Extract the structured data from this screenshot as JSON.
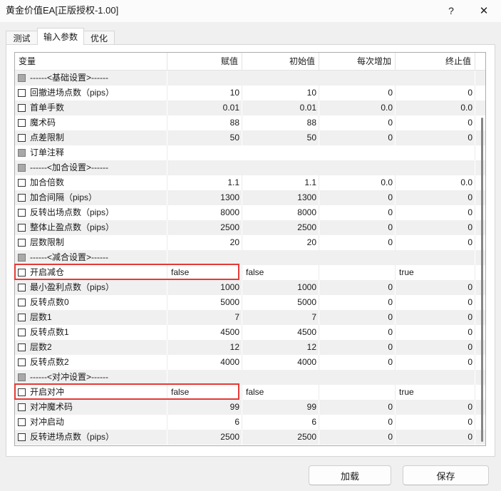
{
  "window": {
    "title": "黄金价值EA[正版授权-1.00]",
    "help_glyph": "?",
    "close_glyph": "✕"
  },
  "icons": {
    "help": "question-mark-icon",
    "close": "close-icon",
    "checkbox": "checkbox-icon"
  },
  "tabs": [
    {
      "label": "测试",
      "active": false
    },
    {
      "label": "输入参数",
      "active": true
    },
    {
      "label": "优化",
      "active": false
    }
  ],
  "table": {
    "columns": [
      "变量",
      "赋值",
      "初始值",
      "每次增加",
      "终止值"
    ],
    "rows": [
      {
        "name": "------<基础设置>------",
        "section": true
      },
      {
        "name": "回撤进场点数（pips）",
        "value": "10",
        "start": "10",
        "step": "0",
        "stop": "0"
      },
      {
        "name": "首单手数",
        "value": "0.01",
        "start": "0.01",
        "step": "0.0",
        "stop": "0.0"
      },
      {
        "name": "魔术码",
        "value": "88",
        "start": "88",
        "step": "0",
        "stop": "0"
      },
      {
        "name": "点差限制",
        "value": "50",
        "start": "50",
        "step": "0",
        "stop": "0"
      },
      {
        "name": "订单注释",
        "checkbox_disabled": true,
        "single_value": true,
        "value": ""
      },
      {
        "name": "------<加合设置>------",
        "section": true
      },
      {
        "name": "加合倍数",
        "value": "1.1",
        "start": "1.1",
        "step": "0.0",
        "stop": "0.0"
      },
      {
        "name": "加合间隔（pips）",
        "value": "1300",
        "start": "1300",
        "step": "0",
        "stop": "0"
      },
      {
        "name": "反转出场点数（pips）",
        "value": "8000",
        "start": "8000",
        "step": "0",
        "stop": "0"
      },
      {
        "name": "整体止盈点数（pips）",
        "value": "2500",
        "start": "2500",
        "step": "0",
        "stop": "0"
      },
      {
        "name": "层数限制",
        "value": "20",
        "start": "20",
        "step": "0",
        "stop": "0"
      },
      {
        "name": "------<减合设置>------",
        "section": true
      },
      {
        "name": "开启减仓",
        "boolean": true,
        "highlighted": true,
        "value": "false",
        "start": "false",
        "step": "",
        "stop": "true"
      },
      {
        "name": "最小盈利点数（pips）",
        "value": "1000",
        "start": "1000",
        "step": "0",
        "stop": "0"
      },
      {
        "name": "反转点数0",
        "value": "5000",
        "start": "5000",
        "step": "0",
        "stop": "0"
      },
      {
        "name": "层数1",
        "value": "7",
        "start": "7",
        "step": "0",
        "stop": "0"
      },
      {
        "name": "反转点数1",
        "value": "4500",
        "start": "4500",
        "step": "0",
        "stop": "0"
      },
      {
        "name": "层数2",
        "value": "12",
        "start": "12",
        "step": "0",
        "stop": "0"
      },
      {
        "name": "反转点数2",
        "value": "4000",
        "start": "4000",
        "step": "0",
        "stop": "0"
      },
      {
        "name": "------<对冲设置>------",
        "section": true
      },
      {
        "name": "开启对冲",
        "boolean": true,
        "highlighted": true,
        "value": "false",
        "start": "false",
        "step": "",
        "stop": "true"
      },
      {
        "name": "对冲魔术码",
        "value": "99",
        "start": "99",
        "step": "0",
        "stop": "0"
      },
      {
        "name": "对冲启动",
        "value": "6",
        "start": "6",
        "step": "0",
        "stop": "0"
      },
      {
        "name": "反转进场点数（pips）",
        "value": "2500",
        "start": "2500",
        "step": "0",
        "stop": "0"
      }
    ]
  },
  "buttons": {
    "load": "加载",
    "save": "保存"
  },
  "colors": {
    "highlight": "#e53935",
    "row_alt": "#f0f0f0",
    "row_plain": "#ffffff",
    "checkbox_disabled": "#a9a9a9"
  }
}
